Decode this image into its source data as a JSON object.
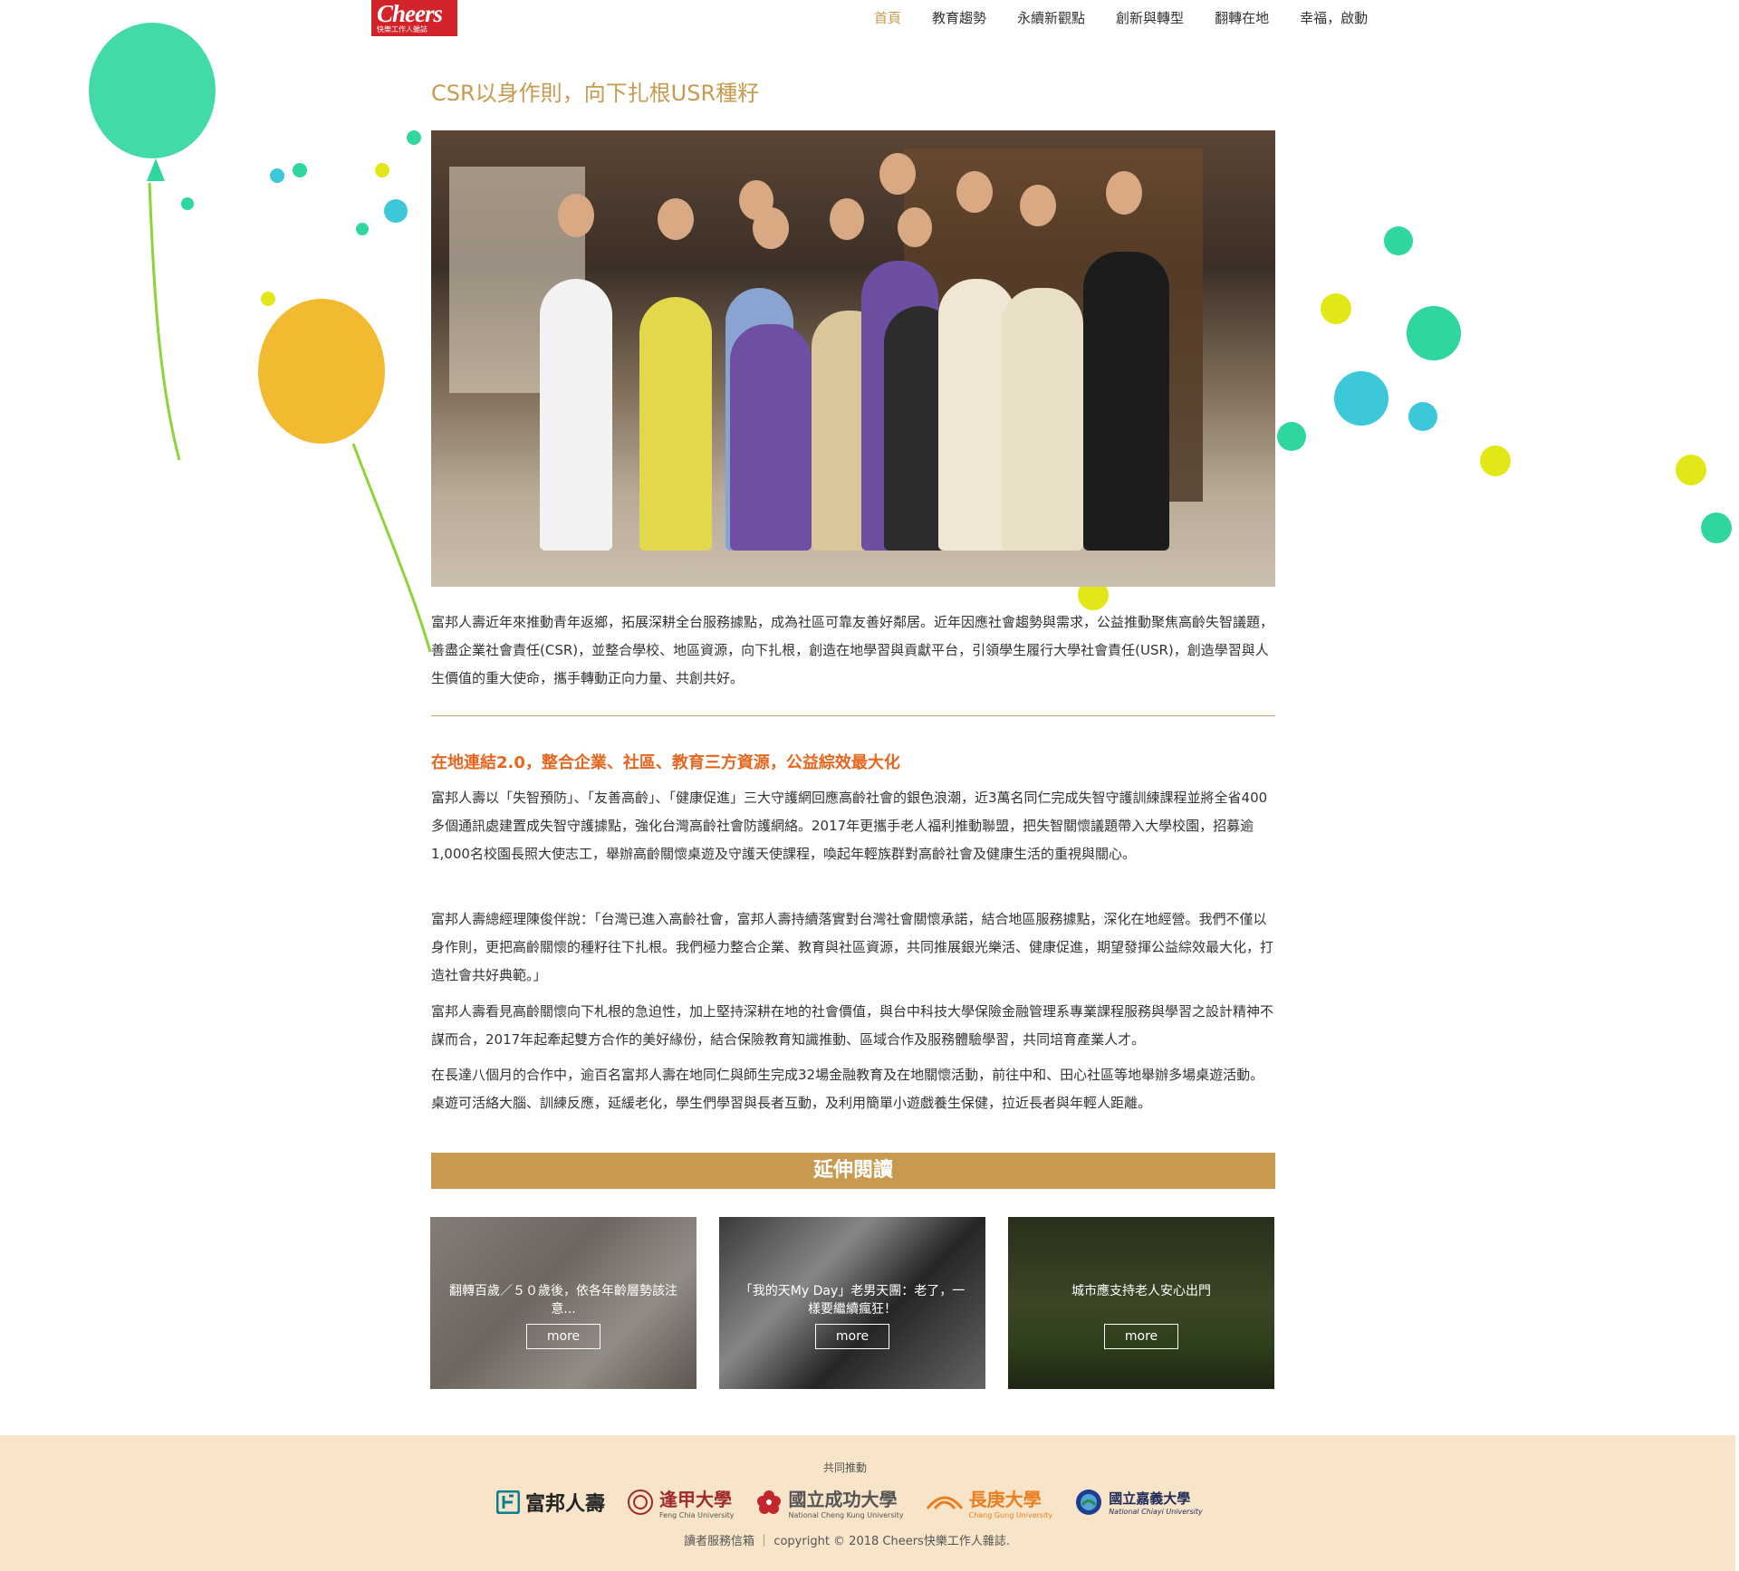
{
  "header": {
    "logo_title": "Cheers",
    "logo_subtitle": "快樂工作人雜誌",
    "nav": [
      {
        "label": "首頁",
        "active": true
      },
      {
        "label": "教育趨勢",
        "active": false
      },
      {
        "label": "永續新觀點",
        "active": false
      },
      {
        "label": "創新與轉型",
        "active": false
      },
      {
        "label": "翻轉在地",
        "active": false
      },
      {
        "label": "幸福，啟動",
        "active": false
      }
    ]
  },
  "article": {
    "title": "CSR以身作則，向下扎根USR種籽",
    "intro": "富邦人壽近年來推動青年返鄉，拓展深耕全台服務據點，成為社區可靠友善好鄰居。近年因應社會趨勢與需求，公益推動聚焦高齡失智議題，善盡企業社會責任(CSR)，並整合學校、地區資源，向下扎根，創造在地學習與貢獻平台，引領學生履行大學社會責任(USR)，創造學習與人生價值的重大使命，攜手轉動正向力量、共創共好。",
    "subheading": "在地連結2.0，整合企業、社區、教育三方資源，公益綜效最大化",
    "paragraphs": [
      "富邦人壽以「失智預防」、「友善高齡」、「健康促進」三大守護網回應高齡社會的銀色浪潮，近3萬名同仁完成失智守護訓練課程並將全省400多個通訊處建置成失智守護據點，強化台灣高齡社會防護網絡。2017年更攜手老人福利推動聯盟，把失智關懷議題帶入大學校園，招募逾1,000名校園長照大使志工，舉辦高齡關懷桌遊及守護天使課程，喚起年輕族群對高齡社會及健康生活的重視與關心。",
      "富邦人壽總經理陳俊伴說：「台灣已進入高齡社會，富邦人壽持續落實對台灣社會關懷承諾，結合地區服務據點，深化在地經營。我們不僅以身作則，更把高齡關懷的種籽往下扎根。我們極力整合企業、教育與社區資源，共同推展銀光樂活、健康促進，期望發揮公益綜效最大化，打造社會共好典範。」",
      "富邦人壽看見高齡關懷向下札根的急迫性，加上堅持深耕在地的社會價值，與台中科技大學保險金融管理系專業課程服務與學習之設計精神不謀而合，2017年起牽起雙方合作的美好緣份，結合保險教育知識推動、區域合作及服務體驗學習，共同培育產業人才。",
      "在長達八個月的合作中，逾百名富邦人壽在地同仁與師生完成32場金融教育及在地關懷活動，前往中和、田心社區等地舉辦多場桌遊活動。桌遊可活絡大腦、訓練反應，延緩老化，學生們學習與長者互動，及利用簡單小遊戲養生保健，拉近長者與年輕人距離。"
    ]
  },
  "extended": {
    "heading": "延伸閱讀",
    "cards": [
      {
        "text": "翻轉百歲／５０歲後，依各年齡層勢該注意...",
        "more": "more"
      },
      {
        "text": "「我的天My Day」老男天團：老了，一樣要繼續瘋狂！",
        "more": "more"
      },
      {
        "text": "城市應支持老人安心出門",
        "more": "more"
      }
    ]
  },
  "footer": {
    "co_promote": "共同推動",
    "sponsors": [
      {
        "name": "富邦人壽",
        "eng": ""
      },
      {
        "name": "逢甲大學",
        "eng": "Feng Chia University"
      },
      {
        "name": "國立成功大學",
        "eng": "National Cheng Kung University"
      },
      {
        "name": "長庚大學",
        "eng": "Chang Gung University"
      },
      {
        "name": "國立嘉義大學",
        "eng": "National Chiayi University"
      }
    ],
    "mail_link": "讀者服務信箱",
    "copyright": "copyright © 2018 Cheers快樂工作人雜誌."
  },
  "colors": {
    "accent_gold": "#c79a4f",
    "subheading_orange": "#e8651e",
    "footer_bg": "#f8e4c8",
    "logo_red": "#d2232a",
    "balloon_green": "#2fd6a0",
    "balloon_yellow": "#f0b31a"
  }
}
